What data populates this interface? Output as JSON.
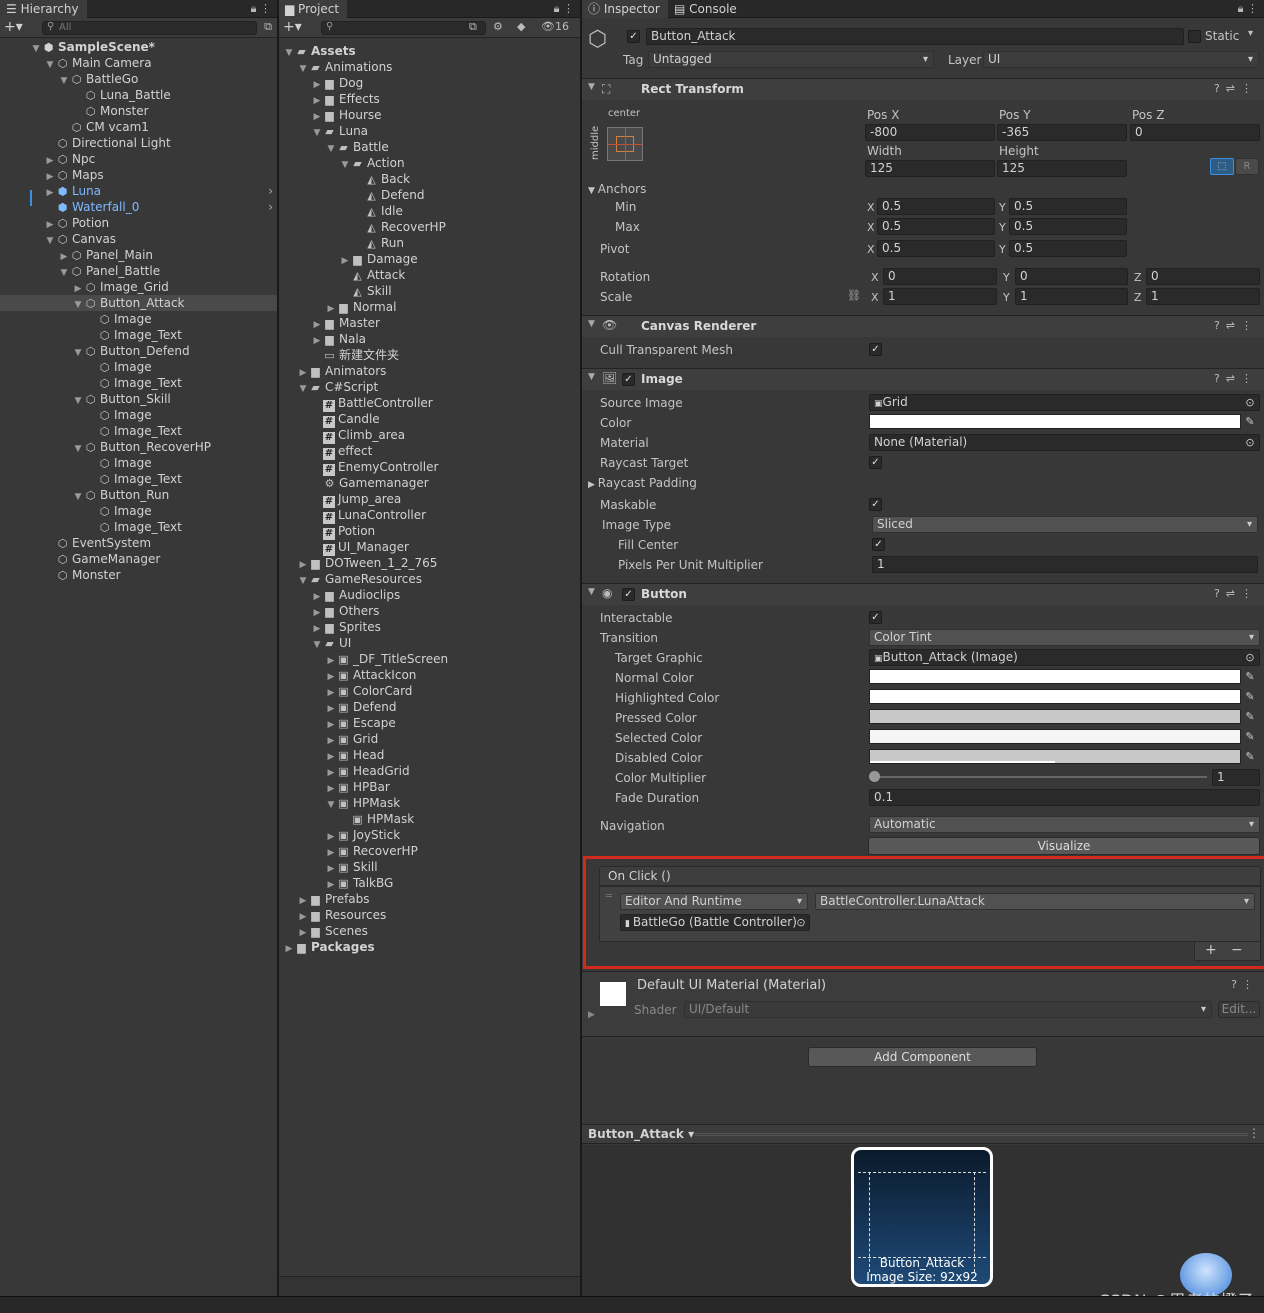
{
  "hierarchy": {
    "tab": "Hierarchy",
    "search_placeholder": "All",
    "items": [
      {
        "l": 0,
        "a": "▼",
        "i": "scene",
        "t": "SampleScene*",
        "bold": true
      },
      {
        "l": 1,
        "a": "▼",
        "i": "cube",
        "t": "Main Camera"
      },
      {
        "l": 2,
        "a": "▼",
        "i": "cube",
        "t": "BattleGo"
      },
      {
        "l": 3,
        "a": "",
        "i": "cube",
        "t": "Luna_Battle"
      },
      {
        "l": 3,
        "a": "",
        "i": "cube",
        "t": "Monster"
      },
      {
        "l": 2,
        "a": "",
        "i": "cube",
        "t": "CM vcam1"
      },
      {
        "l": 1,
        "a": "",
        "i": "cube",
        "t": "Directional Light"
      },
      {
        "l": 1,
        "a": "▶",
        "i": "cube",
        "t": "Npc"
      },
      {
        "l": 1,
        "a": "▶",
        "i": "cube",
        "t": "Maps"
      },
      {
        "l": 1,
        "a": "▶",
        "i": "bcube",
        "t": "Luna",
        "blue": true,
        "more": true
      },
      {
        "l": 1,
        "a": "",
        "i": "bcube",
        "t": "Waterfall_0",
        "blue": true,
        "more": true
      },
      {
        "l": 1,
        "a": "▶",
        "i": "cube",
        "t": "Potion"
      },
      {
        "l": 1,
        "a": "▼",
        "i": "cube",
        "t": "Canvas"
      },
      {
        "l": 2,
        "a": "▶",
        "i": "cube",
        "t": "Panel_Main"
      },
      {
        "l": 2,
        "a": "▼",
        "i": "cube",
        "t": "Panel_Battle"
      },
      {
        "l": 3,
        "a": "▶",
        "i": "cube",
        "t": "Image_Grid"
      },
      {
        "l": 3,
        "a": "▼",
        "i": "cube",
        "t": "Button_Attack",
        "sel": true
      },
      {
        "l": 4,
        "a": "",
        "i": "cube",
        "t": "Image"
      },
      {
        "l": 4,
        "a": "",
        "i": "cube",
        "t": "Image_Text"
      },
      {
        "l": 3,
        "a": "▼",
        "i": "cube",
        "t": "Button_Defend"
      },
      {
        "l": 4,
        "a": "",
        "i": "cube",
        "t": "Image"
      },
      {
        "l": 4,
        "a": "",
        "i": "cube",
        "t": "Image_Text"
      },
      {
        "l": 3,
        "a": "▼",
        "i": "cube",
        "t": "Button_Skill"
      },
      {
        "l": 4,
        "a": "",
        "i": "cube",
        "t": "Image"
      },
      {
        "l": 4,
        "a": "",
        "i": "cube",
        "t": "Image_Text"
      },
      {
        "l": 3,
        "a": "▼",
        "i": "cube",
        "t": "Button_RecoverHP"
      },
      {
        "l": 4,
        "a": "",
        "i": "cube",
        "t": "Image"
      },
      {
        "l": 4,
        "a": "",
        "i": "cube",
        "t": "Image_Text"
      },
      {
        "l": 3,
        "a": "▼",
        "i": "cube",
        "t": "Button_Run"
      },
      {
        "l": 4,
        "a": "",
        "i": "cube",
        "t": "Image"
      },
      {
        "l": 4,
        "a": "",
        "i": "cube",
        "t": "Image_Text"
      },
      {
        "l": 1,
        "a": "",
        "i": "cube",
        "t": "EventSystem"
      },
      {
        "l": 1,
        "a": "",
        "i": "cube",
        "t": "GameManager"
      },
      {
        "l": 1,
        "a": "",
        "i": "cube",
        "t": "Monster"
      }
    ]
  },
  "project": {
    "tab": "Project",
    "hidden_count": "16",
    "items": [
      {
        "l": 0,
        "a": "▼",
        "i": "fopen",
        "t": "Assets",
        "bold": true
      },
      {
        "l": 1,
        "a": "▼",
        "i": "fopen",
        "t": "Animations"
      },
      {
        "l": 2,
        "a": "▶",
        "i": "folder",
        "t": "Dog"
      },
      {
        "l": 2,
        "a": "▶",
        "i": "folder",
        "t": "Effects"
      },
      {
        "l": 2,
        "a": "▶",
        "i": "folder",
        "t": "Hourse"
      },
      {
        "l": 2,
        "a": "▼",
        "i": "fopen",
        "t": "Luna"
      },
      {
        "l": 3,
        "a": "▼",
        "i": "fopen",
        "t": "Battle"
      },
      {
        "l": 4,
        "a": "▼",
        "i": "fopen",
        "t": "Action"
      },
      {
        "l": 5,
        "a": "",
        "i": "anim",
        "t": "Back"
      },
      {
        "l": 5,
        "a": "",
        "i": "anim",
        "t": "Defend"
      },
      {
        "l": 5,
        "a": "",
        "i": "anim",
        "t": "Idle"
      },
      {
        "l": 5,
        "a": "",
        "i": "anim",
        "t": "RecoverHP"
      },
      {
        "l": 5,
        "a": "",
        "i": "anim",
        "t": "Run"
      },
      {
        "l": 4,
        "a": "▶",
        "i": "folder",
        "t": "Damage"
      },
      {
        "l": 4,
        "a": "",
        "i": "anim",
        "t": "Attack"
      },
      {
        "l": 4,
        "a": "",
        "i": "anim",
        "t": "Skill"
      },
      {
        "l": 3,
        "a": "▶",
        "i": "folder",
        "t": "Normal"
      },
      {
        "l": 2,
        "a": "▶",
        "i": "folder",
        "t": "Master"
      },
      {
        "l": 2,
        "a": "▶",
        "i": "folder",
        "t": "Nala"
      },
      {
        "l": 2,
        "a": "",
        "i": "fempty",
        "t": "新建文件夹"
      },
      {
        "l": 1,
        "a": "▶",
        "i": "folder",
        "t": "Animators"
      },
      {
        "l": 1,
        "a": "▼",
        "i": "fopen",
        "t": "C#Script"
      },
      {
        "l": 2,
        "a": "",
        "i": "hash",
        "t": "BattleController"
      },
      {
        "l": 2,
        "a": "",
        "i": "hash",
        "t": "Candle"
      },
      {
        "l": 2,
        "a": "",
        "i": "hash",
        "t": "Climb_area"
      },
      {
        "l": 2,
        "a": "",
        "i": "hash",
        "t": "effect"
      },
      {
        "l": 2,
        "a": "",
        "i": "hash",
        "t": "EnemyController"
      },
      {
        "l": 2,
        "a": "",
        "i": "gear",
        "t": "Gamemanager"
      },
      {
        "l": 2,
        "a": "",
        "i": "hash",
        "t": "Jump_area"
      },
      {
        "l": 2,
        "a": "",
        "i": "hash",
        "t": "LunaController"
      },
      {
        "l": 2,
        "a": "",
        "i": "hash",
        "t": "Potion"
      },
      {
        "l": 2,
        "a": "",
        "i": "hash",
        "t": "UI_Manager"
      },
      {
        "l": 1,
        "a": "▶",
        "i": "folder",
        "t": "DOTween_1_2_765"
      },
      {
        "l": 1,
        "a": "▼",
        "i": "fopen",
        "t": "GameResources"
      },
      {
        "l": 2,
        "a": "▶",
        "i": "folder",
        "t": "Audioclips"
      },
      {
        "l": 2,
        "a": "▶",
        "i": "folder",
        "t": "Others"
      },
      {
        "l": 2,
        "a": "▶",
        "i": "folder",
        "t": "Sprites"
      },
      {
        "l": 2,
        "a": "▼",
        "i": "fopen",
        "t": "UI"
      },
      {
        "l": 3,
        "a": "▶",
        "i": "sprite",
        "t": "_DF_TitleScreen"
      },
      {
        "l": 3,
        "a": "▶",
        "i": "sprite",
        "t": "AttackIcon"
      },
      {
        "l": 3,
        "a": "▶",
        "i": "sprite",
        "t": "ColorCard"
      },
      {
        "l": 3,
        "a": "▶",
        "i": "sprite",
        "t": "Defend"
      },
      {
        "l": 3,
        "a": "▶",
        "i": "sprite",
        "t": "Escape"
      },
      {
        "l": 3,
        "a": "▶",
        "i": "sprite",
        "t": "Grid"
      },
      {
        "l": 3,
        "a": "▶",
        "i": "sprite",
        "t": "Head"
      },
      {
        "l": 3,
        "a": "▶",
        "i": "sprite",
        "t": "HeadGrid"
      },
      {
        "l": 3,
        "a": "▶",
        "i": "sprite",
        "t": "HPBar"
      },
      {
        "l": 3,
        "a": "▼",
        "i": "sprite",
        "t": "HPMask"
      },
      {
        "l": 4,
        "a": "",
        "i": "sprite",
        "t": "HPMask"
      },
      {
        "l": 3,
        "a": "▶",
        "i": "sprite",
        "t": "JoyStick"
      },
      {
        "l": 3,
        "a": "▶",
        "i": "sprite",
        "t": "RecoverHP"
      },
      {
        "l": 3,
        "a": "▶",
        "i": "sprite",
        "t": "Skill"
      },
      {
        "l": 3,
        "a": "▶",
        "i": "sprite",
        "t": "TalkBG"
      },
      {
        "l": 1,
        "a": "▶",
        "i": "folder",
        "t": "Prefabs"
      },
      {
        "l": 1,
        "a": "▶",
        "i": "folder",
        "t": "Resources"
      },
      {
        "l": 1,
        "a": "▶",
        "i": "folder",
        "t": "Scenes"
      },
      {
        "l": 0,
        "a": "▶",
        "i": "folder",
        "t": "Packages",
        "bold": true
      }
    ]
  },
  "inspector": {
    "tab": "Inspector",
    "tab2": "Console",
    "name": "Button_Attack",
    "static": "Static",
    "tag_label": "Tag",
    "tag": "Untagged",
    "layer_label": "Layer",
    "layer": "UI",
    "rect": {
      "title": "Rect Transform",
      "anchor_h": "center",
      "anchor_v": "middle",
      "posx_l": "Pos X",
      "posy_l": "Pos Y",
      "posz_l": "Pos Z",
      "posx": "-800",
      "posy": "-365",
      "posz": "0",
      "w_l": "Width",
      "h_l": "Height",
      "w": "125",
      "h": "125",
      "r": "R",
      "anchors": "Anchors",
      "min": "Min",
      "max": "Max",
      "pivot": "Pivot",
      "rotation": "Rotation",
      "scale": "Scale",
      "minx": "0.5",
      "miny": "0.5",
      "maxx": "0.5",
      "maxy": "0.5",
      "pivx": "0.5",
      "pivy": "0.5",
      "rotx": "0",
      "roty": "0",
      "rotz": "0",
      "scx": "1",
      "scy": "1",
      "scz": "1",
      "x": "X",
      "y": "Y",
      "z": "Z"
    },
    "canvas": {
      "title": "Canvas Renderer",
      "cull": "Cull Transparent Mesh"
    },
    "image": {
      "title": "Image",
      "source_l": "Source Image",
      "source": "Grid",
      "color_l": "Color",
      "material_l": "Material",
      "material": "None (Material)",
      "raycast_l": "Raycast Target",
      "padding_l": "Raycast Padding",
      "maskable_l": "Maskable",
      "type_l": "Image Type",
      "type": "Sliced",
      "fill_l": "Fill Center",
      "ppu_l": "Pixels Per Unit Multiplier",
      "ppu": "1"
    },
    "button": {
      "title": "Button",
      "inter_l": "Interactable",
      "trans_l": "Transition",
      "trans": "Color Tint",
      "target_l": "Target Graphic",
      "target": "Button_Attack (Image)",
      "normal_l": "Normal Color",
      "high_l": "Highlighted Color",
      "press_l": "Pressed Color",
      "selc_l": "Selected Color",
      "dis_l": "Disabled Color",
      "mult_l": "Color Multiplier",
      "mult": "1",
      "fade_l": "Fade Duration",
      "fade": "0.1",
      "nav_l": "Navigation",
      "nav": "Automatic",
      "visualize": "Visualize",
      "onclick": "On Click ()",
      "runtime": "Editor And Runtime",
      "func": "BattleController.LunaAttack",
      "obj": "BattleGo (Battle Controller)",
      "plus": "+",
      "minus": "−"
    },
    "material": {
      "title": "Default UI Material (Material)",
      "shader_l": "Shader",
      "shader": "UI/Default",
      "edit": "Edit..."
    },
    "add": "Add Component",
    "preview": {
      "title": "Button_Attack",
      "caption1": "Button_Attack",
      "caption2": "Image Size: 92x92"
    },
    "watermark": "CSDN @思考的橙子"
  },
  "colors": {
    "highlight": "#d22a1c",
    "selection": "#2c5d87"
  }
}
